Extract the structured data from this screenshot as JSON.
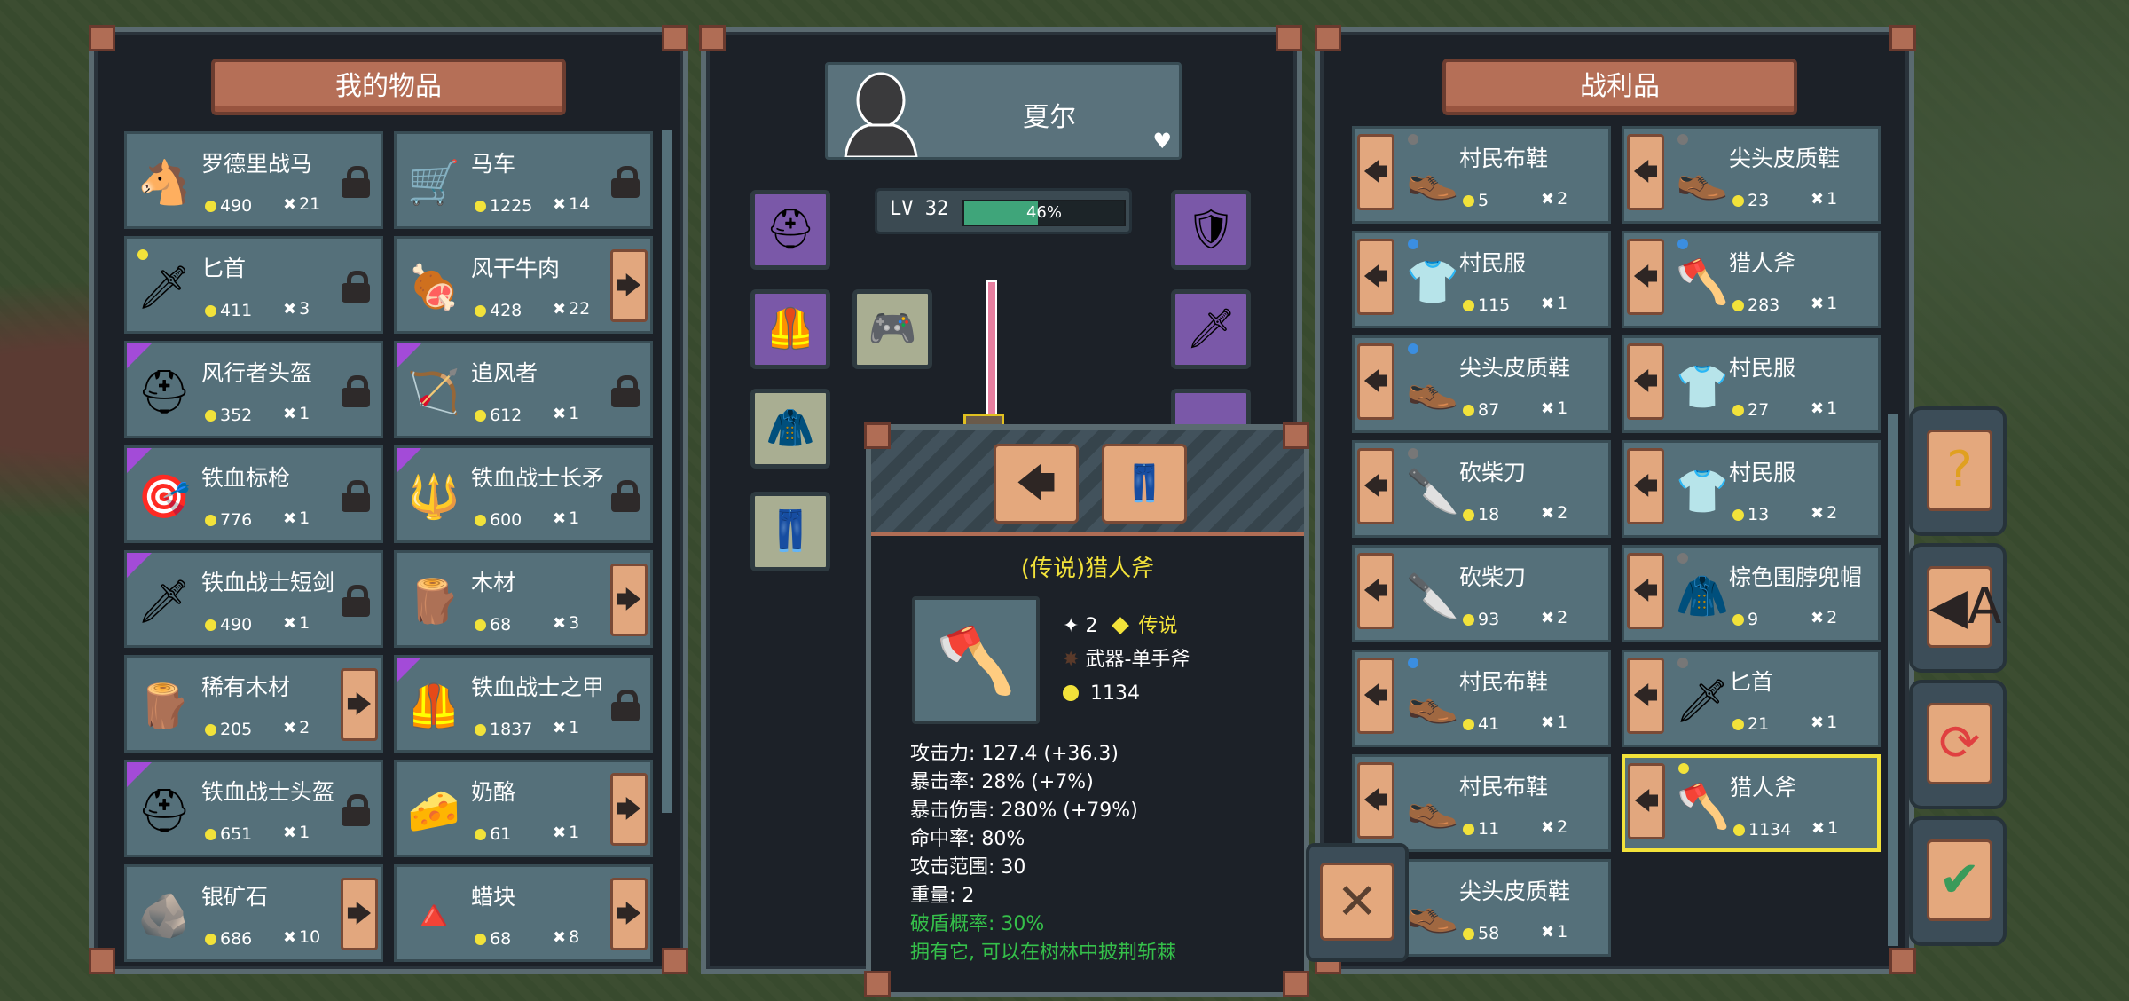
{
  "left_panel": {
    "title": "我的物品",
    "items": [
      {
        "name": "罗德里战马",
        "price": "490",
        "qty": "21",
        "icon": "horse-icon",
        "glyph": "🐴",
        "action": "lock",
        "rarity": ""
      },
      {
        "name": "马车",
        "price": "1225",
        "qty": "14",
        "icon": "cart-icon",
        "glyph": "🛒",
        "action": "lock",
        "rarity": ""
      },
      {
        "name": "匕首",
        "price": "411",
        "qty": "3",
        "icon": "dagger-icon",
        "glyph": "🗡",
        "action": "lock",
        "rarity": "yellow-dot"
      },
      {
        "name": "风干牛肉",
        "price": "428",
        "qty": "22",
        "icon": "meat-icon",
        "glyph": "🍖",
        "action": "arrow",
        "rarity": ""
      },
      {
        "name": "风行者头盔",
        "price": "352",
        "qty": "1",
        "icon": "helmet-icon",
        "glyph": "⛑",
        "action": "lock",
        "rarity": "purple"
      },
      {
        "name": "追风者",
        "price": "612",
        "qty": "1",
        "icon": "bow-icon",
        "glyph": "🏹",
        "action": "lock",
        "rarity": "purple"
      },
      {
        "name": "铁血标枪",
        "price": "776",
        "qty": "1",
        "icon": "javelin-icon",
        "glyph": "🎯",
        "action": "lock",
        "rarity": "purple"
      },
      {
        "name": "铁血战士长矛",
        "price": "600",
        "qty": "1",
        "icon": "spear-icon",
        "glyph": "🔱",
        "action": "lock",
        "rarity": "purple"
      },
      {
        "name": "铁血战士短剑",
        "price": "490",
        "qty": "1",
        "icon": "short-sword-icon",
        "glyph": "🗡",
        "action": "lock",
        "rarity": "purple"
      },
      {
        "name": "木材",
        "price": "68",
        "qty": "3",
        "icon": "wood-icon",
        "glyph": "🪵",
        "action": "arrow",
        "rarity": ""
      },
      {
        "name": "稀有木材",
        "price": "205",
        "qty": "2",
        "icon": "rare-wood-icon",
        "glyph": "🪵",
        "action": "arrow",
        "rarity": ""
      },
      {
        "name": "铁血战士之甲",
        "price": "1837",
        "qty": "1",
        "icon": "armor-icon",
        "glyph": "🦺",
        "action": "lock",
        "rarity": "purple"
      },
      {
        "name": "铁血战士头盔",
        "price": "651",
        "qty": "1",
        "icon": "warrior-helmet-icon",
        "glyph": "⛑",
        "action": "lock",
        "rarity": "purple"
      },
      {
        "name": "奶酪",
        "price": "61",
        "qty": "1",
        "icon": "cheese-icon",
        "glyph": "🧀",
        "action": "arrow",
        "rarity": ""
      },
      {
        "name": "银矿石",
        "price": "686",
        "qty": "10",
        "icon": "silver-ore-icon",
        "glyph": "🪨",
        "action": "arrow",
        "rarity": ""
      },
      {
        "name": "蜡块",
        "price": "68",
        "qty": "8",
        "icon": "wax-icon",
        "glyph": "🔺",
        "action": "arrow",
        "rarity": ""
      }
    ]
  },
  "character": {
    "name": "夏尔",
    "level": "LV 32",
    "xp_percent": "46%",
    "xp_fraction": 0.46
  },
  "right_panel": {
    "title": "战利品",
    "items": [
      {
        "name": "村民布鞋",
        "price": "5",
        "qty": "2",
        "icon": "shoes-icon",
        "glyph": "👞",
        "dot": "#777"
      },
      {
        "name": "尖头皮质鞋",
        "price": "23",
        "qty": "1",
        "icon": "pointed-shoes-icon",
        "glyph": "👞",
        "dot": "#777"
      },
      {
        "name": "村民服",
        "price": "115",
        "qty": "1",
        "icon": "clothes-icon",
        "glyph": "👕",
        "dot": "#3b8ee0"
      },
      {
        "name": "猎人斧",
        "price": "283",
        "qty": "1",
        "icon": "axe-icon",
        "glyph": "🪓",
        "dot": "#3b8ee0"
      },
      {
        "name": "尖头皮质鞋",
        "price": "87",
        "qty": "1",
        "icon": "pointed-shoes-icon",
        "glyph": "👞",
        "dot": "#3b8ee0"
      },
      {
        "name": "村民服",
        "price": "27",
        "qty": "1",
        "icon": "clothes-icon",
        "glyph": "👕",
        "dot": ""
      },
      {
        "name": "砍柴刀",
        "price": "18",
        "qty": "2",
        "icon": "knife-icon",
        "glyph": "🔪",
        "dot": "#777"
      },
      {
        "name": "村民服",
        "price": "13",
        "qty": "2",
        "icon": "clothes-icon",
        "glyph": "👕",
        "dot": ""
      },
      {
        "name": "砍柴刀",
        "price": "93",
        "qty": "2",
        "icon": "knife-icon",
        "glyph": "🔪",
        "dot": ""
      },
      {
        "name": "棕色围脖兜帽",
        "price": "9",
        "qty": "2",
        "icon": "hood-icon",
        "glyph": "🧥",
        "dot": "#777"
      },
      {
        "name": "村民布鞋",
        "price": "41",
        "qty": "1",
        "icon": "shoes-icon",
        "glyph": "👞",
        "dot": "#3b8ee0"
      },
      {
        "name": "匕首",
        "price": "21",
        "qty": "1",
        "icon": "dagger-icon",
        "glyph": "🗡",
        "dot": "#777"
      },
      {
        "name": "村民布鞋",
        "price": "11",
        "qty": "2",
        "icon": "shoes-icon",
        "glyph": "👞",
        "dot": ""
      },
      {
        "name": "猎人斧",
        "price": "1134",
        "qty": "1",
        "icon": "axe-icon",
        "glyph": "🪓",
        "dot": "#f2e23a",
        "selected": true
      },
      {
        "name": "尖头皮质鞋",
        "price": "58",
        "qty": "1",
        "icon": "pointed-shoes-icon",
        "glyph": "👞",
        "dot": ""
      }
    ]
  },
  "tooltip": {
    "title": "(传说)猎人斧",
    "tier": "2",
    "rarity": "传说",
    "type": "武器-单手斧",
    "price": "1134",
    "stats": [
      "攻击力: 127.4 (+36.3)",
      "暴击率: 28% (+7%)",
      "暴击伤害: 280% (+79%)",
      "命中率: 80%",
      "攻击范围: 30",
      "重量: 2"
    ],
    "special": "破盾概率: 30%",
    "description": "拥有它, 可以在树林中披荆斩棘"
  },
  "side_buttons": [
    {
      "name": "help-button",
      "glyph": "?",
      "color": "#e0a020"
    },
    {
      "name": "sort-button",
      "glyph": "◀A",
      "color": "#2a2424"
    },
    {
      "name": "refresh-button",
      "glyph": "⟳",
      "color": "#e04040"
    },
    {
      "name": "confirm-button",
      "glyph": "✔",
      "color": "#3a9a5a"
    }
  ],
  "close_label": "✕"
}
